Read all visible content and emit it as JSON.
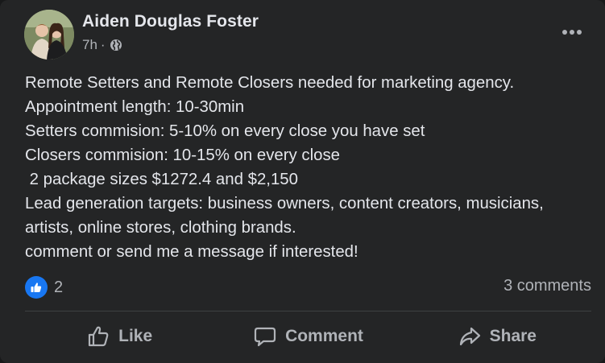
{
  "post": {
    "author_name": "Aiden Douglas Foster",
    "timestamp": "7h",
    "separator": "·",
    "privacy_icon": "globe-icon",
    "more_icon": "more-options-icon",
    "body_lines": [
      "Remote Setters and Remote Closers needed for marketing agency.",
      "Appointment length: 10-30min",
      "Setters commision: 5-10% on every close you have set",
      "Closers commision: 10-15% on every close",
      " 2 package sizes $1272.4 and $2,150",
      "Lead generation targets: business owners, content creators, musicians,",
      "artists, online stores, clothing brands.",
      "comment or send me a message if interested!"
    ]
  },
  "stats": {
    "reaction_icon": "like-reaction-icon",
    "reaction_count": "2",
    "comments_count": "3 comments"
  },
  "actions": {
    "like_label": "Like",
    "comment_label": "Comment",
    "share_label": "Share"
  },
  "colors": {
    "card_background": "#242526",
    "primary_text": "#e4e6eb",
    "secondary_text": "#b0b3b8",
    "accent_blue": "#1877f2",
    "divider": "#3e4042"
  }
}
